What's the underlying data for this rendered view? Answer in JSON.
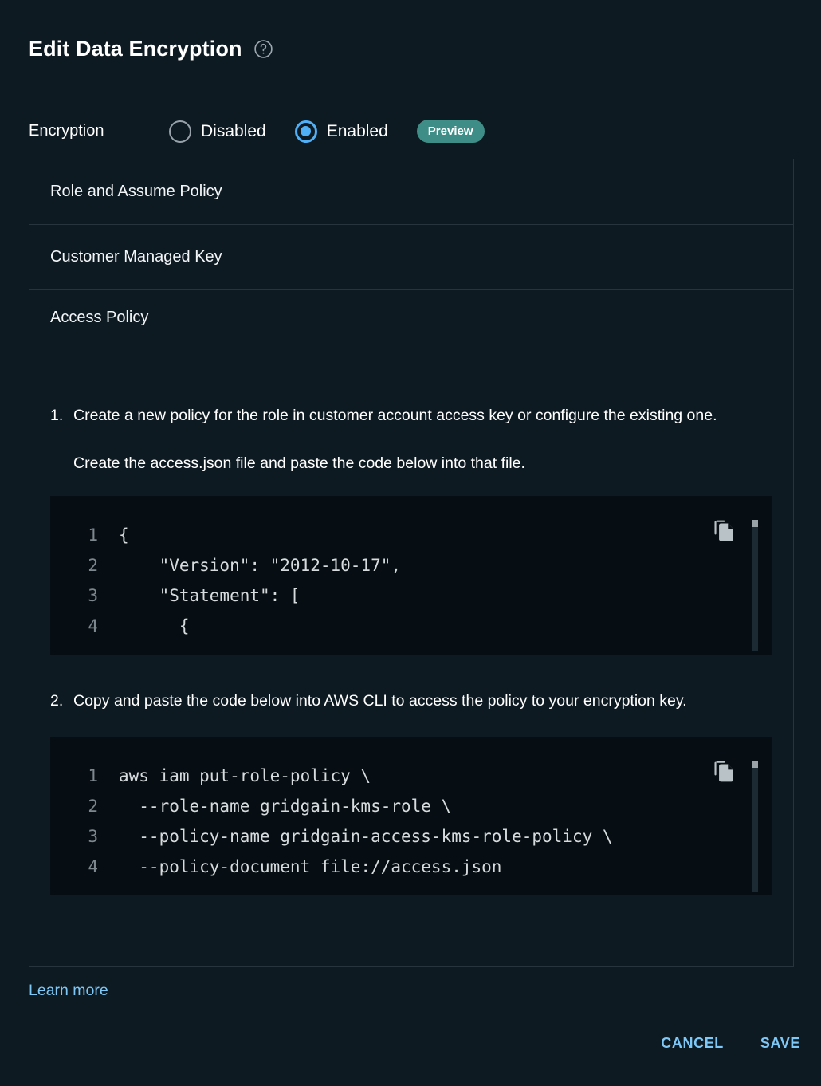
{
  "header": {
    "title": "Edit Data Encryption",
    "help_icon": "help-circle-icon"
  },
  "encryption": {
    "label": "Encryption",
    "options": [
      {
        "label": "Disabled",
        "selected": false
      },
      {
        "label": "Enabled",
        "selected": true
      }
    ],
    "badge": "Preview"
  },
  "sections": [
    {
      "title": "Role and Assume Policy",
      "open": false
    },
    {
      "title": "Customer Managed Key",
      "open": false
    },
    {
      "title": "Access Policy",
      "open": true
    }
  ],
  "access_policy": {
    "step1": {
      "number": "1.",
      "text": "Create a new policy for the role in customer account access key or configure the existing one.",
      "sub": "Create the access.json file and paste the code below into that file.",
      "code": {
        "lines": [
          "1",
          "2",
          "3",
          "4"
        ],
        "text": "{\n    \"Version\": \"2012-10-17\",\n    \"Statement\": [\n      {",
        "copy_icon": "copy-icon"
      }
    },
    "step2": {
      "number": "2.",
      "text": "Copy and paste the code below into AWS CLI to access the policy to your encryption key.",
      "code": {
        "lines": [
          "1",
          "2",
          "3",
          "4"
        ],
        "text": "aws iam put-role-policy \\\n  --role-name gridgain-kms-role \\\n  --policy-name gridgain-access-kms-role-policy \\\n  --policy-document file://access.json",
        "copy_icon": "copy-icon"
      }
    }
  },
  "footer": {
    "learn_more": "Learn more",
    "cancel": "CANCEL",
    "save": "SAVE"
  },
  "colors": {
    "page_background": "#0e1a22",
    "code_background": "#070e13",
    "accent_blue": "#4fb0f8",
    "link_blue": "#7ec8f7",
    "badge_teal": "#3e8e87",
    "divider": "#27333d"
  }
}
